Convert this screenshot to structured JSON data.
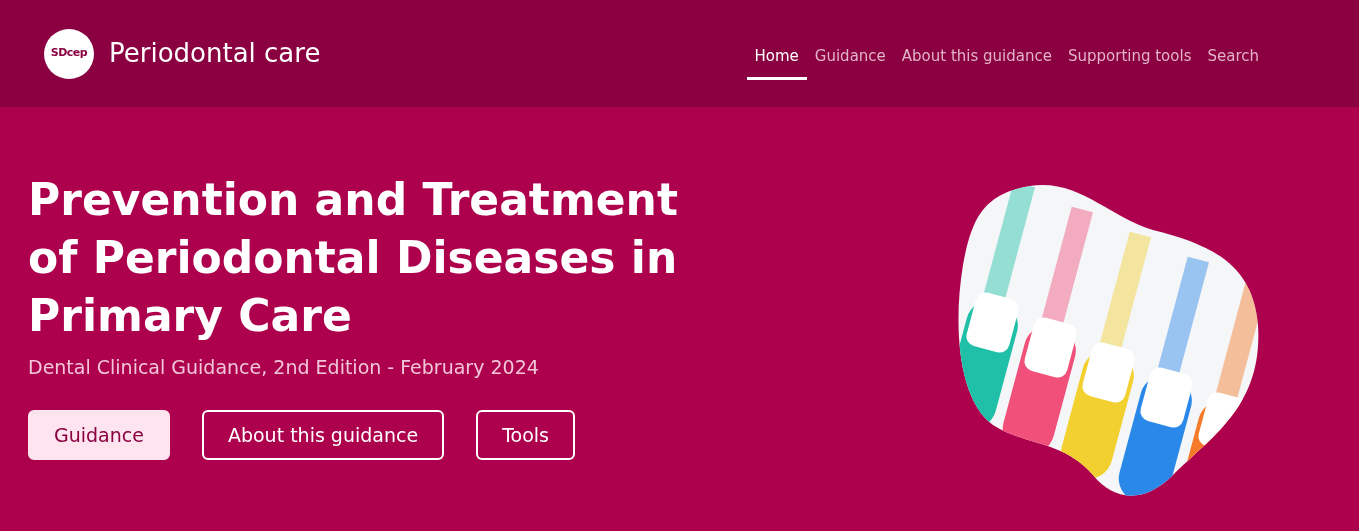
{
  "header": {
    "logo_text": "SDcep",
    "site_title": "Periodontal care"
  },
  "nav": [
    {
      "label": "Home",
      "selected": true
    },
    {
      "label": "Guidance",
      "selected": false
    },
    {
      "label": "About this guidance",
      "selected": false
    },
    {
      "label": "Supporting tools",
      "selected": false
    },
    {
      "label": "Search",
      "selected": false
    }
  ],
  "hero": {
    "title": "Prevention and Treatment of Periodontal Diseases in Primary Care",
    "subtitle": "Dental Clinical Guidance, 2nd Edition - February 2024",
    "buttons": [
      {
        "label": "Guidance",
        "kind": "filled"
      },
      {
        "label": "About this guidance",
        "kind": "outline"
      },
      {
        "label": "Tools",
        "kind": "outline"
      }
    ]
  }
}
